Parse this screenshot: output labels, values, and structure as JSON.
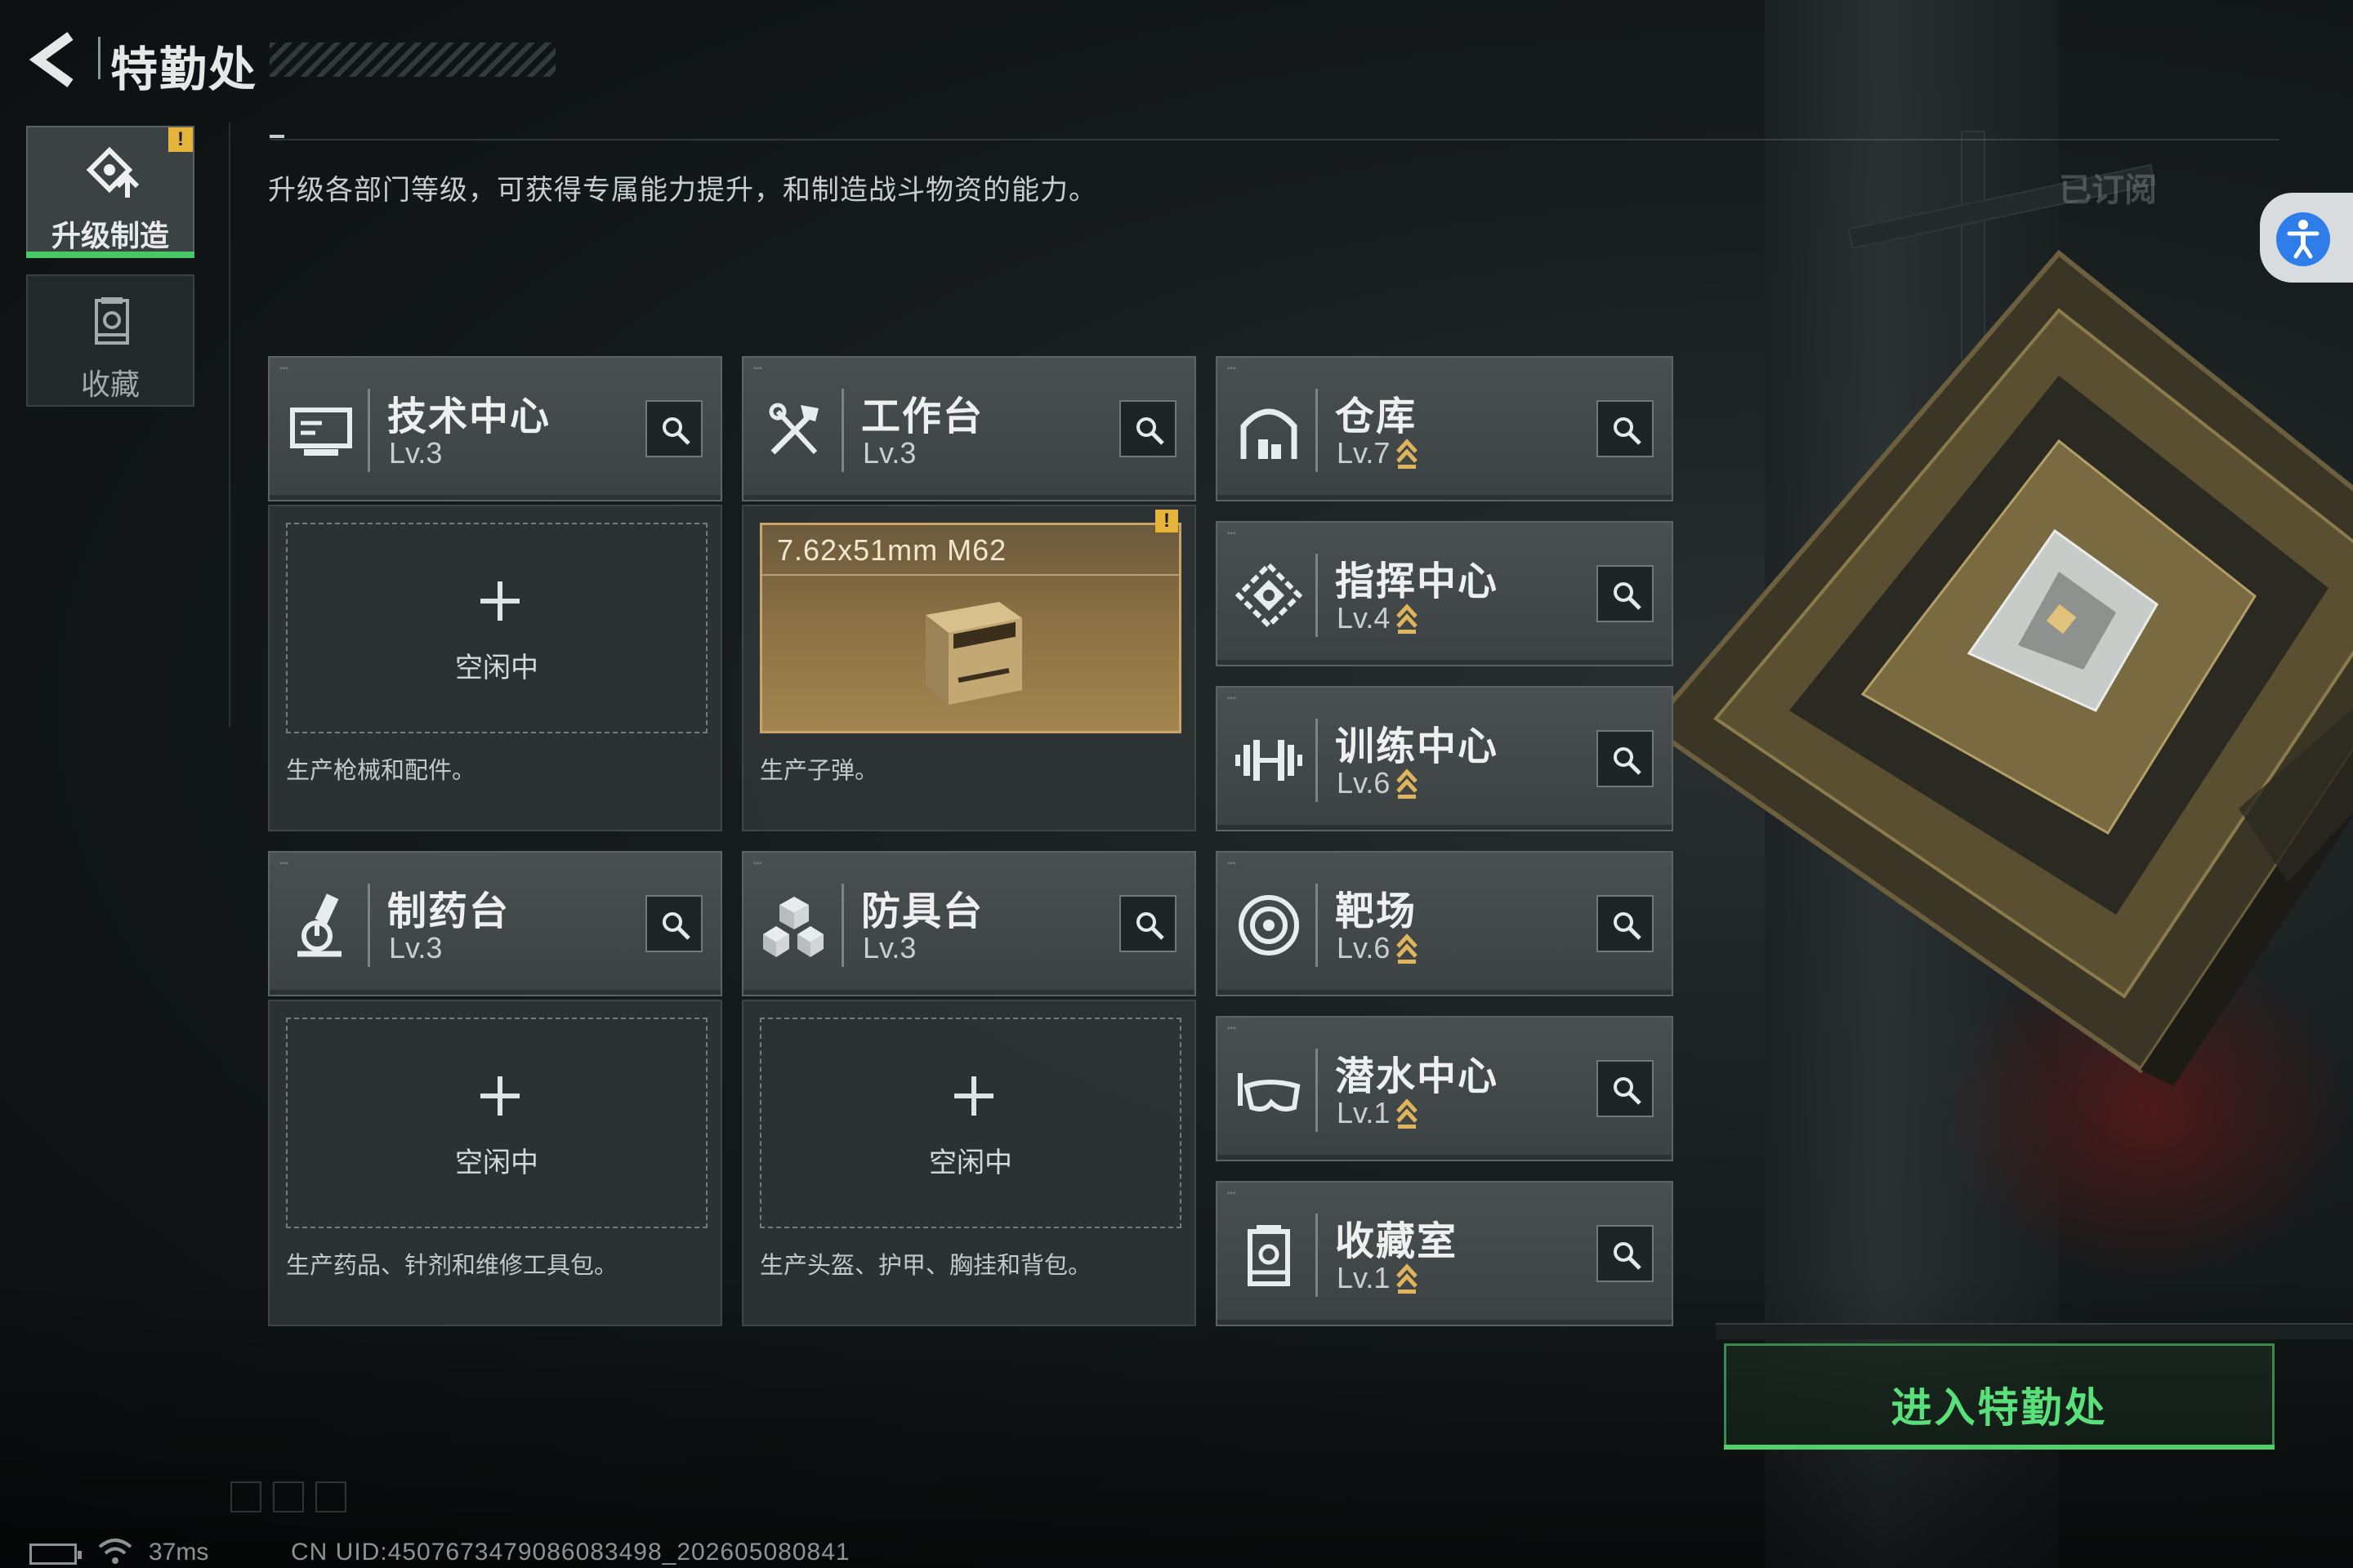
{
  "header": {
    "title": "特勤处",
    "back_icon": "chevron-left-icon"
  },
  "sidebar": {
    "items": [
      {
        "label": "升级制造",
        "icon": "upgrade-gear-icon",
        "active": true,
        "badge": "!"
      },
      {
        "label": "收藏",
        "icon": "collection-vault-icon",
        "active": false
      }
    ]
  },
  "description": "升级各部门等级，可获得专属能力提升，和制造战斗物资的能力。",
  "subscribed_label": "已订阅",
  "facilities": [
    {
      "name": "技术中心",
      "level": "Lv.3",
      "icon": "computer-icon",
      "slot": {
        "state": "空闲中",
        "desc": "生产枪械和配件。"
      }
    },
    {
      "name": "工作台",
      "level": "Lv.3",
      "icon": "tools-icon",
      "slot": {
        "product": "7.62x51mm M62",
        "badge": "!",
        "desc": "生产子弹。"
      }
    },
    {
      "name": "制药台",
      "level": "Lv.3",
      "icon": "microscope-icon",
      "slot": {
        "state": "空闲中",
        "desc": "生产药品、针剂和维修工具包。"
      }
    },
    {
      "name": "防具台",
      "level": "Lv.3",
      "icon": "cubes-icon",
      "slot": {
        "state": "空闲中",
        "desc": "生产头盔、护甲、胸挂和背包。"
      }
    }
  ],
  "facilities_right": [
    {
      "name": "仓库",
      "level": "Lv.7",
      "icon": "warehouse-icon"
    },
    {
      "name": "指挥中心",
      "level": "Lv.4",
      "icon": "command-icon"
    },
    {
      "name": "训练中心",
      "level": "Lv.6",
      "icon": "dumbbell-icon"
    },
    {
      "name": "靶场",
      "level": "Lv.6",
      "icon": "target-icon"
    },
    {
      "name": "潜水中心",
      "level": "Lv.1",
      "icon": "diving-mask-icon"
    },
    {
      "name": "收藏室",
      "level": "Lv.1",
      "icon": "trophy-room-icon"
    }
  ],
  "enter_button": "进入特勤处",
  "footer": {
    "ping": "37ms",
    "uid": "CN UID:4507673479086083498_202605080841"
  },
  "colors": {
    "accent_green": "#4fd06c",
    "warning": "#e6b43b",
    "upgrade_arrow": "#e0b45a"
  }
}
